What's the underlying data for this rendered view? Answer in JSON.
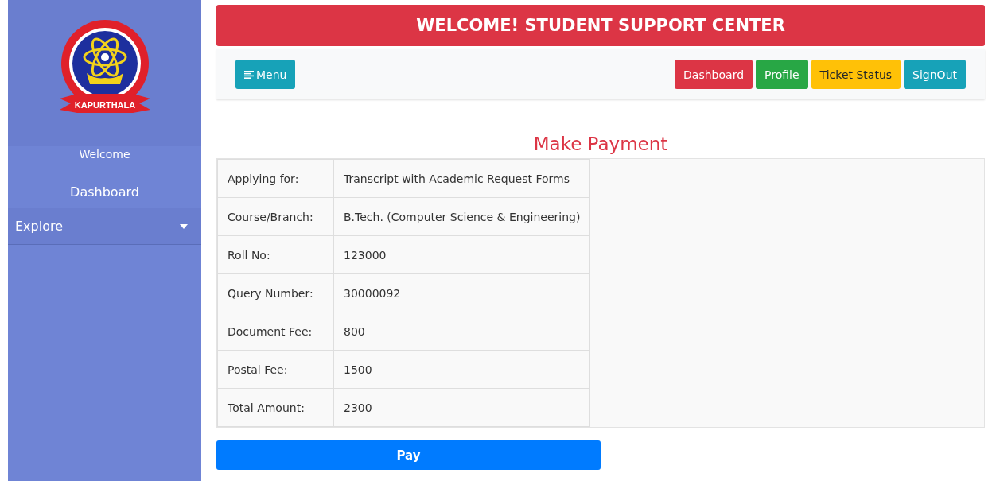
{
  "sidebar": {
    "logo_ribbon": "KAPURTHALA",
    "welcome": "Welcome",
    "items": [
      {
        "label": "Dashboard",
        "kind": "link",
        "expanded": false
      },
      {
        "label": "Explore",
        "kind": "dropdown",
        "expanded": false
      }
    ]
  },
  "header": {
    "title": "WELCOME! STUDENT SUPPORT CENTER"
  },
  "navbar": {
    "menu_button": "Menu",
    "buttons": [
      {
        "label": "Dashboard",
        "color": "#dc3545"
      },
      {
        "label": "Profile",
        "color": "#28a745"
      },
      {
        "label": "Ticket Status",
        "color": "#ffc107"
      },
      {
        "label": "SignOut",
        "color": "#17a2b8"
      }
    ]
  },
  "page_title": "Make Payment",
  "table": {
    "rows": [
      {
        "label": "Applying for:",
        "value": "Transcript with Academic Request Forms"
      },
      {
        "label": "Course/Branch:",
        "value": "B.Tech. (Computer Science & Engineering)"
      },
      {
        "label": "Roll No:",
        "value": "123000"
      },
      {
        "label": "Query Number:",
        "value": "30000092"
      },
      {
        "label": "Document Fee:",
        "value": "800"
      },
      {
        "label": "Postal Fee:",
        "value": "1500"
      },
      {
        "label": "Total Amount:",
        "value": "2300"
      }
    ]
  },
  "pay_button": "Pay"
}
